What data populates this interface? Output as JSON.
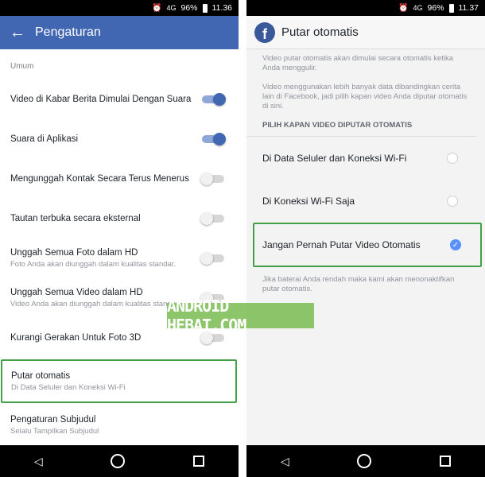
{
  "left": {
    "status": {
      "network": "4G",
      "battery": "96%",
      "time": "11.36"
    },
    "appbar": {
      "title": "Pengaturan",
      "back_icon": "arrow-left-icon"
    },
    "section": "Umum",
    "rows": [
      {
        "title": "Video di Kabar Berita Dimulai Dengan Suara",
        "subtitle": "",
        "toggle": true
      },
      {
        "title": "Suara di Aplikasi",
        "subtitle": "",
        "toggle": true
      },
      {
        "title": "Mengunggah Kontak Secara Terus Menerus",
        "subtitle": "",
        "toggle": false
      },
      {
        "title": "Tautan terbuka secara eksternal",
        "subtitle": "",
        "toggle": false
      },
      {
        "title": "Unggah Semua Foto dalam HD",
        "subtitle": "Foto Anda akan diunggah dalam kualitas standar.",
        "toggle": false
      },
      {
        "title": "Unggah Semua Video dalam HD",
        "subtitle": "Video Anda akan diunggah dalam kualitas standar.",
        "toggle": false
      },
      {
        "title": "Kurangi Gerakan Untuk Foto 3D",
        "subtitle": "",
        "toggle": false
      }
    ],
    "autoplay": {
      "title": "Putar otomatis",
      "subtitle": "Di Data Seluler dan Koneksi Wi-Fi"
    },
    "captions": {
      "title": "Pengaturan Subjudul",
      "subtitle": "Selalu Tampilkan Subjudul"
    }
  },
  "right": {
    "status": {
      "network": "4G",
      "battery": "96%",
      "time": "11.37"
    },
    "appbar": {
      "title": "Putar otomatis",
      "logo": "f"
    },
    "desc1": "Video putar otomatis akan dimulai secara otomatis ketika Anda menggulir.",
    "desc2": "Video menggunakan lebih banyak data dibandingkan cerita lain di Facebook, jadi pilih kapan video Anda diputar otomatis di sini.",
    "heading": "PILIH KAPAN VIDEO DIPUTAR OTOMATIS",
    "options": [
      {
        "label": "Di Data Seluler dan Koneksi Wi-Fi",
        "selected": false
      },
      {
        "label": "Di Koneksi Wi-Fi Saja",
        "selected": false
      },
      {
        "label": "Jangan Pernah Putar Video Otomatis",
        "selected": true
      }
    ],
    "footer": "Jika baterai Anda rendah maka kami akan menonaktifkan putar otomatis."
  },
  "watermark": "ANDROID HEBAT.COM",
  "colors": {
    "facebook_blue": "#4267b2",
    "highlight_green": "#43a047",
    "radio_blue": "#5890ff"
  }
}
